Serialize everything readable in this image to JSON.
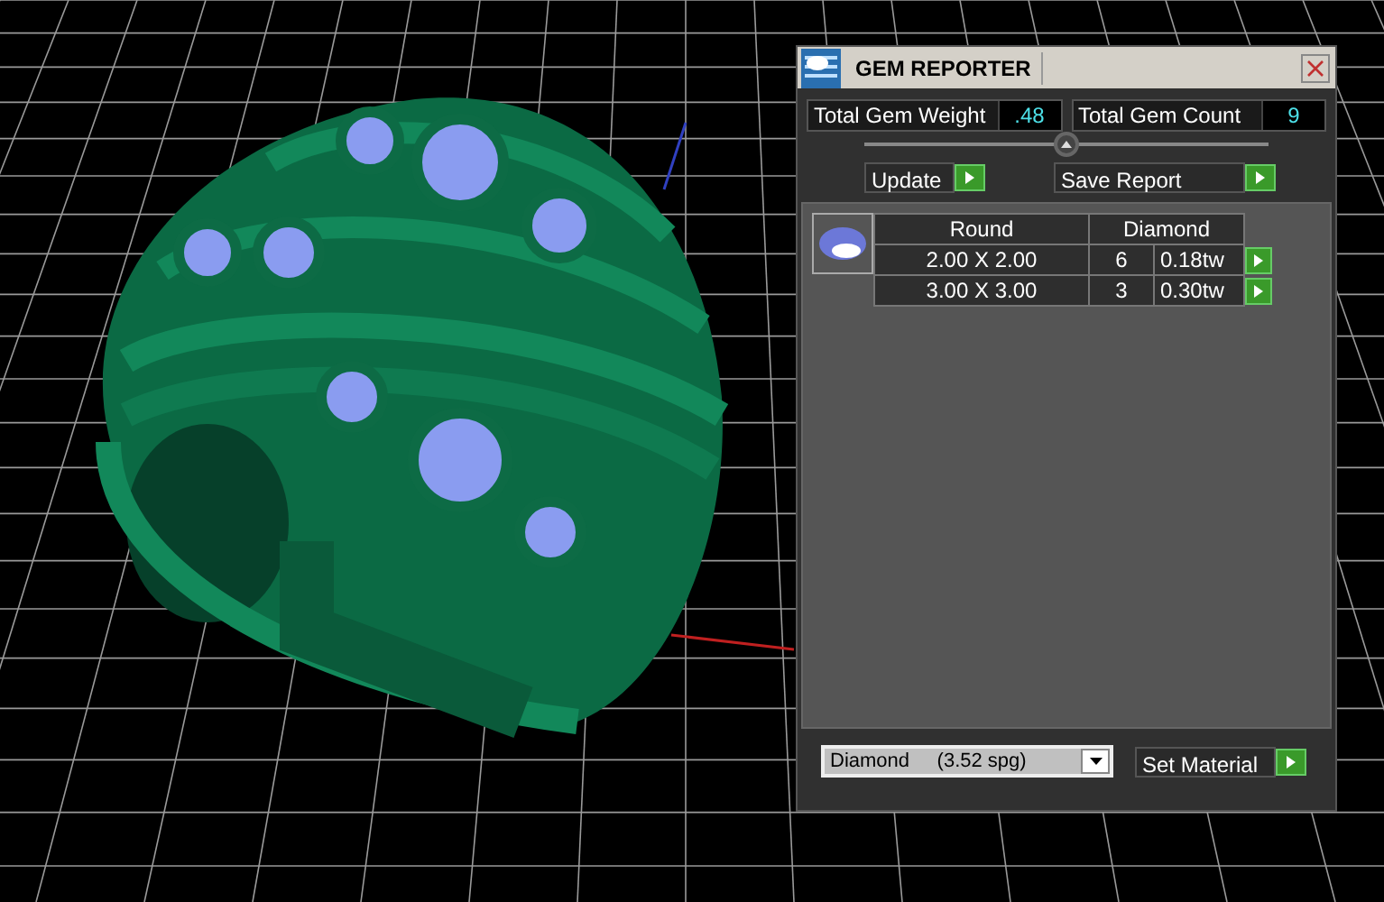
{
  "window": {
    "title": "GEM REPORTER"
  },
  "totals": [
    {
      "label": "Total Gem Weight",
      "value": ".48"
    },
    {
      "label": "Total Gem Count",
      "value": "9"
    }
  ],
  "slider": {
    "level": 0.5
  },
  "buttons": [
    "Update",
    "Save Report"
  ],
  "gem_table": {
    "shape": "Round",
    "material": "Diamond",
    "rows": [
      {
        "size": "2.00 X 2.00",
        "count": "6",
        "weight": "0.18tw"
      },
      {
        "size": "3.00 X 3.00",
        "count": "3",
        "weight": "0.30tw"
      }
    ]
  },
  "material_select": {
    "value": "Diamond     (3.52 spg)"
  },
  "set_material_button": "Set Material"
}
